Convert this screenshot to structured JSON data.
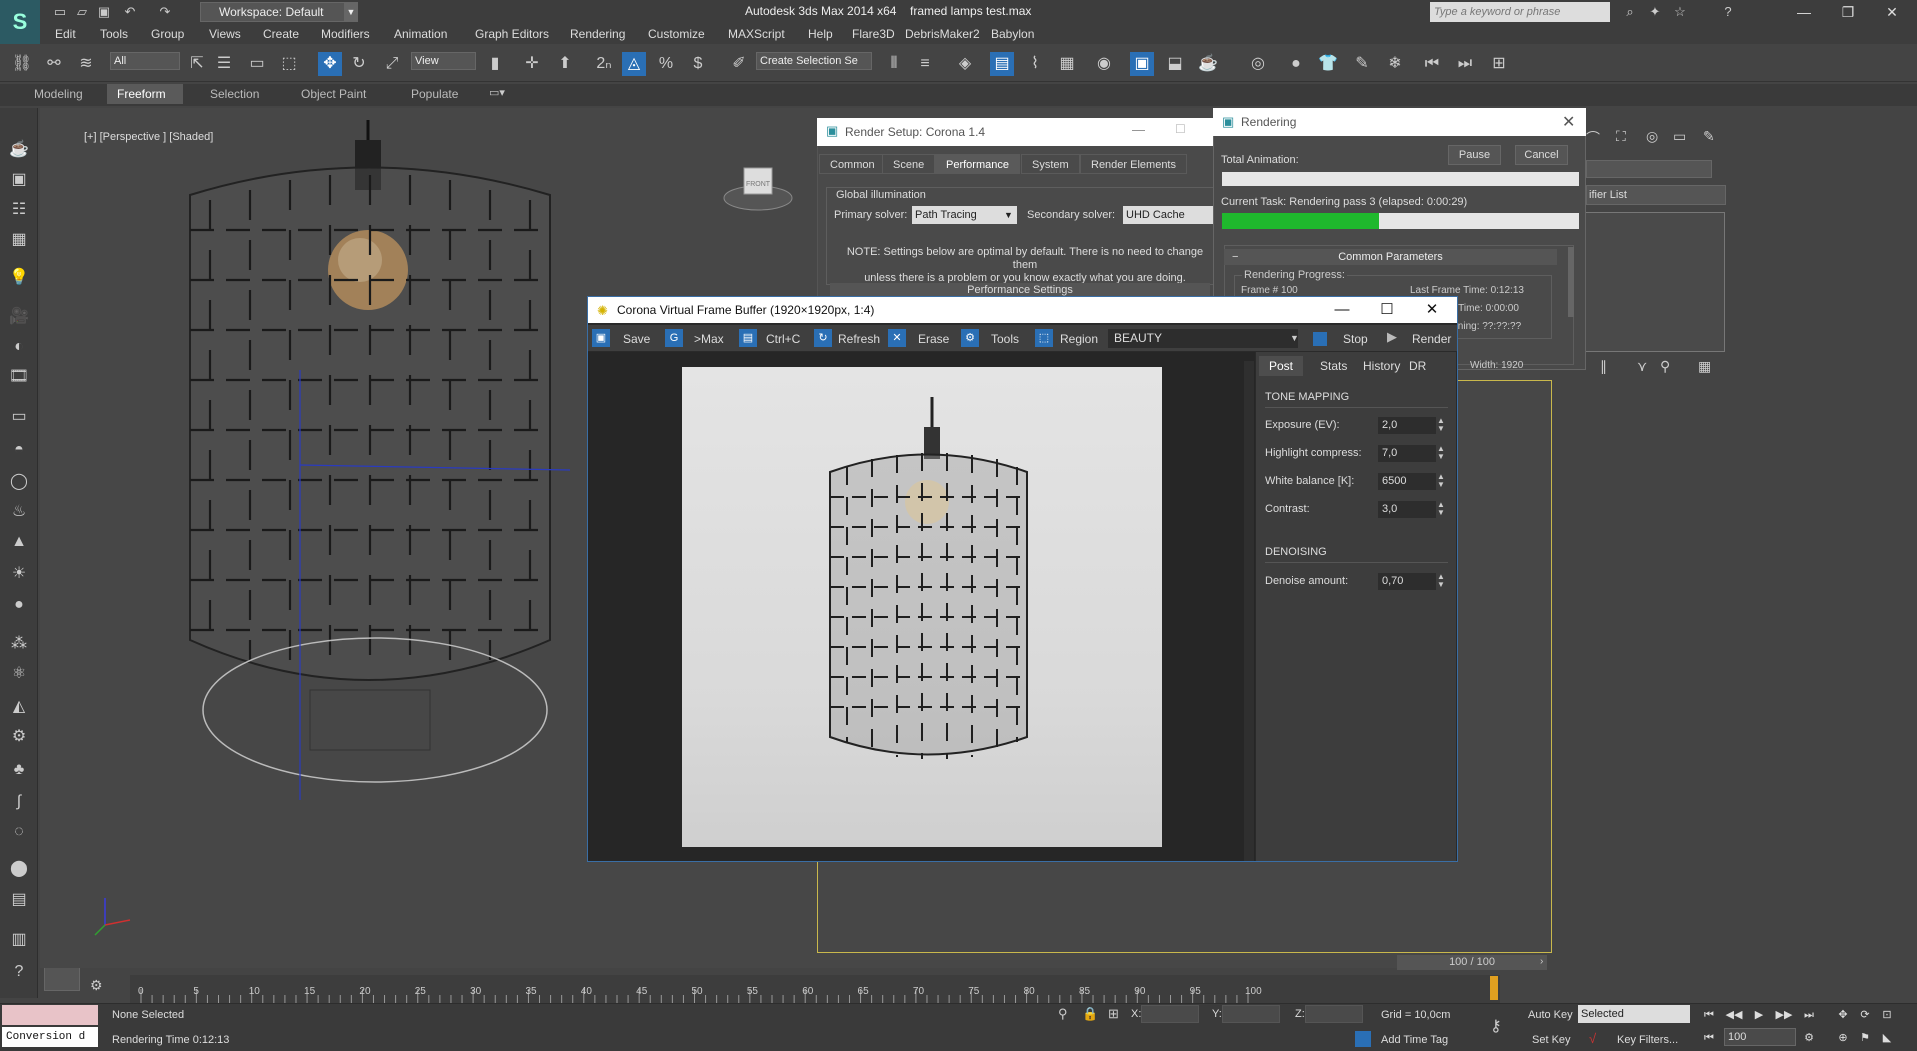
{
  "titlebar": {
    "workspace": "Workspace: Default",
    "app_title": "Autodesk 3ds Max  2014 x64",
    "file_title": "framed lamps test.max",
    "search_placeholder": "Type a keyword or phrase"
  },
  "menu": [
    "Edit",
    "Tools",
    "Group",
    "Views",
    "Create",
    "Modifiers",
    "Animation",
    "Graph Editors",
    "Rendering",
    "Customize",
    "MAXScript",
    "Help",
    "Flare3D",
    "DebrisMaker2",
    "Babylon"
  ],
  "toolbar": {
    "selection_filter": "All",
    "ref_coord": "View",
    "named_selection": "Create Selection Se"
  },
  "ribbon_tabs": [
    "Modeling",
    "Freeform",
    "Selection",
    "Object Paint",
    "Populate"
  ],
  "viewport": {
    "label": "[+] [Perspective ] [Shaded]",
    "viewcube_label": "FRONT"
  },
  "command_panel": {
    "modifier_list": "ifier List"
  },
  "render_setup": {
    "title": "Render Setup: Corona 1.4",
    "tabs": [
      "Common",
      "Scene",
      "Performance",
      "System",
      "Render Elements"
    ],
    "active_tab": "Performance",
    "gi_label": "Global illumination",
    "primary_label": "Primary solver:",
    "primary_value": "Path Tracing",
    "secondary_label": "Secondary solver:",
    "secondary_value": "UHD Cache",
    "note_line1": "NOTE: Settings below are optimal by default. There is no need to change them",
    "note_line2": "unless there is a problem or you know exactly what you are doing.",
    "perf_settings": "Performance Settings"
  },
  "rendering": {
    "title": "Rendering",
    "pause": "Pause",
    "cancel": "Cancel",
    "total_animation": "Total Animation:",
    "current_task": "Current Task:   Rendering pass 3 (elapsed: 0:00:29)",
    "task_progress": 0.44,
    "common_params": "Common Parameters",
    "render_progress": "Rendering Progress:",
    "frame": "Frame #  100",
    "last_frame_time": "Last Frame Time:  0:12:13",
    "elapsed_time": "d Time:  0:00:00",
    "remaining": "aining:  ??:??:??",
    "width": "Width: 1920"
  },
  "vfb": {
    "title": "Corona Virtual Frame Buffer (1920×1920px, 1:4)",
    "toolbar": {
      "save": "Save",
      "tomax": ">Max",
      "copy": "Ctrl+C",
      "refresh": "Refresh",
      "erase": "Erase",
      "tools": "Tools",
      "region": "Region",
      "channel": "BEAUTY",
      "stop": "Stop",
      "render": "Render"
    },
    "side_tabs": [
      "Post",
      "Stats",
      "History",
      "DR"
    ],
    "tone_mapping": "TONE MAPPING",
    "exposure_label": "Exposure (EV):",
    "exposure_val": "2,0",
    "highlight_label": "Highlight compress:",
    "highlight_val": "7,0",
    "wb_label": "White balance [K]:",
    "wb_val": "6500",
    "contrast_label": "Contrast:",
    "contrast_val": "3,0",
    "denoising": "DENOISING",
    "denoise_label": "Denoise amount:",
    "denoise_val": "0,70"
  },
  "timeline": {
    "slider": "100 / 100",
    "ticks": [
      "0",
      "5",
      "10",
      "15",
      "20",
      "25",
      "30",
      "35",
      "40",
      "45",
      "50",
      "55",
      "60",
      "65",
      "70",
      "75",
      "80",
      "85",
      "90",
      "95",
      "100"
    ]
  },
  "status": {
    "conversion": "Conversion d",
    "none_selected": "None Selected",
    "render_time": "Rendering Time  0:12:13",
    "x_label": "X:",
    "y_label": "Y:",
    "z_label": "Z:",
    "grid": "Grid = 10,0cm",
    "add_time_tag": "Add Time Tag",
    "auto_key": "Auto Key",
    "set_key": "Set Key",
    "selected": "Selected",
    "key_filters": "Key Filters...",
    "frame": "100"
  }
}
